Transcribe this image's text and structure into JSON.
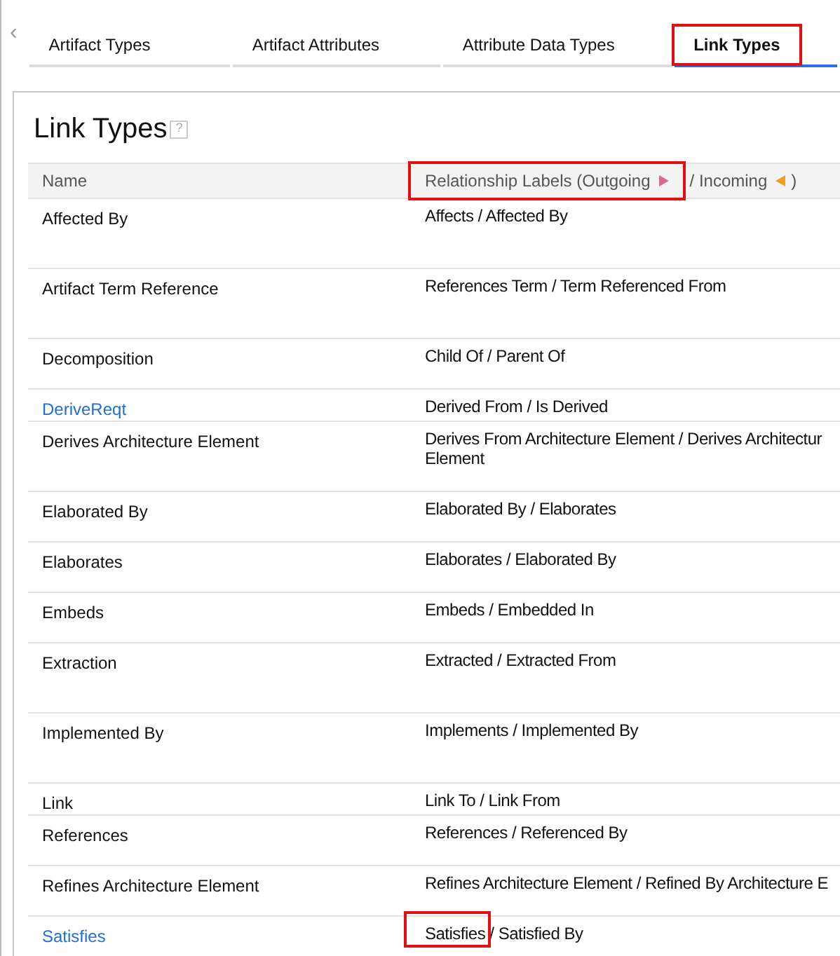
{
  "scroll_left": "‹",
  "help_icon": "?",
  "tabs": [
    {
      "label": "Artifact Types",
      "selected": false,
      "highlighted": false
    },
    {
      "label": "Artifact Attributes",
      "selected": false,
      "highlighted": false
    },
    {
      "label": "Attribute Data Types",
      "selected": false,
      "highlighted": false
    },
    {
      "label": "Link Types",
      "selected": true,
      "highlighted": true
    }
  ],
  "title": "Link Types",
  "table": {
    "columns": [
      {
        "label": "Name",
        "highlighted": false
      },
      {
        "label": "Relationship Labels (Outgoing",
        "after": "/ Incoming",
        "close": ")",
        "highlighted": true
      }
    ],
    "rows": [
      {
        "name": "Affected By",
        "link": false,
        "labels": "Affects / Affected By",
        "highlighted": false
      },
      {
        "name": "Artifact Term Reference",
        "link": false,
        "labels": "References Term / Term Referenced From",
        "highlighted": false
      },
      {
        "name": "Decomposition",
        "link": false,
        "labels": "Child Of / Parent Of",
        "highlighted": false
      },
      {
        "name": "DeriveReqt",
        "link": true,
        "labels": "Derived From / Is Derived",
        "highlighted": false
      },
      {
        "name": "Derives Architecture Element",
        "link": false,
        "labels": "Derives From Architecture Element / Derives Architectur\nElement",
        "highlighted": false
      },
      {
        "name": "Elaborated By",
        "link": false,
        "labels": "Elaborated By / Elaborates",
        "highlighted": false
      },
      {
        "name": "Elaborates",
        "link": false,
        "labels": "Elaborates / Elaborated By",
        "highlighted": false
      },
      {
        "name": "Embeds",
        "link": false,
        "labels": "Embeds / Embedded In",
        "highlighted": false
      },
      {
        "name": "Extraction",
        "link": false,
        "labels": "Extracted / Extracted From",
        "highlighted": false
      },
      {
        "name": "Implemented By",
        "link": false,
        "labels": "Implements / Implemented By",
        "highlighted": false
      },
      {
        "name": "Link",
        "link": false,
        "labels": "Link To / Link From",
        "highlighted": false
      },
      {
        "name": "References",
        "link": false,
        "labels": "References / Referenced By",
        "highlighted": false
      },
      {
        "name": "Refines Architecture Element",
        "link": false,
        "labels": "Refines Architecture Element / Refined By Architecture E",
        "highlighted": false
      },
      {
        "name": "Satisfies",
        "link": true,
        "labels": "Satisfies / Satisfied By",
        "highlighted": true
      }
    ]
  }
}
